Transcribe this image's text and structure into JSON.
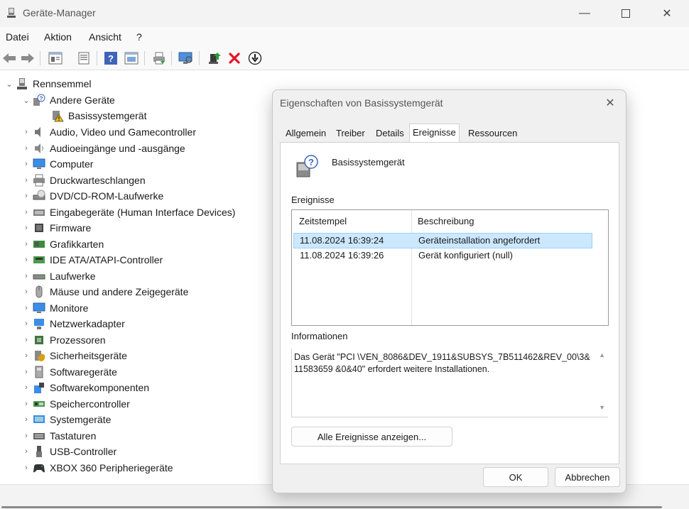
{
  "window": {
    "title": "Geräte-Manager"
  },
  "menu": [
    "Datei",
    "Aktion",
    "Ansicht",
    "?"
  ],
  "toolbar_icons": [
    "back-icon",
    "forward-icon",
    "properties-icon",
    "show-hide-icon",
    "help-icon",
    "view-icon",
    "print-icon",
    "scan-hardware-icon",
    "update-driver-icon",
    "uninstall-icon",
    "download-icon"
  ],
  "tree": {
    "root": "Rennsemmel",
    "other_devices": "Andere Geräte",
    "basis_device": "Basissystemgerät",
    "categories": [
      "Audio, Video und Gamecontroller",
      "Audioeingänge und -ausgänge",
      "Computer",
      "Druckwarteschlangen",
      "DVD/CD-ROM-Laufwerke",
      "Eingabegeräte (Human Interface Devices)",
      "Firmware",
      "Grafikkarten",
      "IDE ATA/ATAPI-Controller",
      "Laufwerke",
      "Mäuse und andere Zeigegeräte",
      "Monitore",
      "Netzwerkadapter",
      "Prozessoren",
      "Sicherheitsgeräte",
      "Softwaregeräte",
      "Softwarekomponenten",
      "Speichercontroller",
      "Systemgeräte",
      "Tastaturen",
      "USB-Controller",
      "XBOX 360 Peripheriegeräte"
    ]
  },
  "dialog": {
    "title": "Eigenschaften von Basissystemgerät",
    "tabs": [
      "Allgemein",
      "Treiber",
      "Details",
      "Ereignisse",
      "Ressourcen"
    ],
    "active_tab": "Ereignisse",
    "device_name": "Basissystemgerät",
    "events_label": "Ereignisse",
    "columns": [
      "Zeitstempel",
      "Beschreibung"
    ],
    "events": [
      {
        "time": "11.08.2024 16:39:24",
        "desc": "Geräteinstallation angefordert"
      },
      {
        "time": "11.08.2024 16:39:26",
        "desc": "Gerät konfiguriert (null)"
      }
    ],
    "info_label": "Informationen",
    "info_text": "Das Gerät \"PCI \\VEN_8086&DEV_1911&SUBSYS_7B511462&REV_00\\3&11583659 &0&40\" erfordert weitere Installationen.",
    "all_events_button": "Alle Ereignisse anzeigen...",
    "ok_button": "OK",
    "cancel_button": "Abbrechen"
  },
  "colors": {
    "selection": "#cce8ff",
    "selection_border": "#99d1ff",
    "error_red": "#e81123",
    "warning_yellow": "#f4c000"
  }
}
